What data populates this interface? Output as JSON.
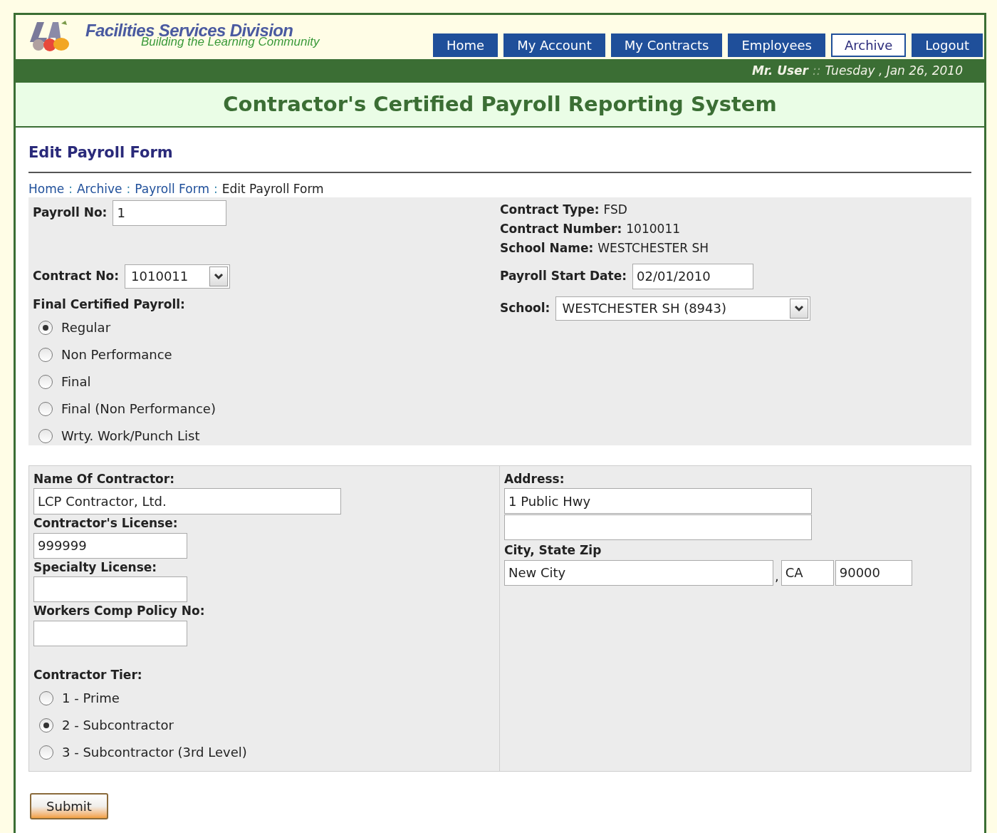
{
  "header": {
    "org_name": "Facilities Services Division",
    "tagline": "Building the Learning Community"
  },
  "nav": [
    {
      "label": "Home",
      "selected": false
    },
    {
      "label": "My Account",
      "selected": false
    },
    {
      "label": "My Contracts",
      "selected": false
    },
    {
      "label": "Employees",
      "selected": false
    },
    {
      "label": "Archive",
      "selected": true
    },
    {
      "label": "Logout",
      "selected": false
    }
  ],
  "user_bar": {
    "user": "Mr. User",
    "separator": "::",
    "date": "Tuesday , Jan 26, 2010"
  },
  "system_title": "Contractor's Certified Payroll Reporting System",
  "page_title": "Edit Payroll Form",
  "breadcrumb": [
    {
      "label": "Home",
      "kind": "link"
    },
    {
      "label": "Archive",
      "kind": "link"
    },
    {
      "label": "Payroll Form",
      "kind": "link"
    },
    {
      "label": "Edit Payroll Form",
      "kind": "current"
    }
  ],
  "breadcrumb_separator": ":",
  "payroll": {
    "payroll_no": {
      "label": "Payroll No:",
      "value": "1"
    },
    "contract_no": {
      "label": "Contract No:",
      "value": "1010011"
    },
    "final_certified": {
      "label": "Final Certified Payroll:",
      "options": [
        {
          "label": "Regular",
          "selected": true
        },
        {
          "label": "Non Performance",
          "selected": false
        },
        {
          "label": "Final",
          "selected": false
        },
        {
          "label": "Final (Non Performance)",
          "selected": false
        },
        {
          "label": "Wrty. Work/Punch List",
          "selected": false
        }
      ]
    },
    "info": [
      {
        "label": "Contract Type:",
        "value": "FSD"
      },
      {
        "label": "Contract Number:",
        "value": "1010011"
      },
      {
        "label": "School Name:",
        "value": "WESTCHESTER SH"
      }
    ],
    "start_date": {
      "label": "Payroll Start Date:",
      "value": "02/01/2010"
    },
    "school": {
      "label": "School:",
      "value": "WESTCHESTER SH (8943)"
    }
  },
  "contractor": {
    "name": {
      "label": "Name Of Contractor:",
      "value": "LCP Contractor, Ltd."
    },
    "license": {
      "label": "Contractor's License:",
      "value": "999999"
    },
    "specialty": {
      "label": "Specialty License:"
    },
    "workers_comp": {
      "label": "Workers Comp Policy No:"
    },
    "tier": {
      "label": "Contractor Tier:",
      "options": [
        {
          "label": "1 - Prime",
          "selected": false
        },
        {
          "label": "2 - Subcontractor",
          "selected": true
        },
        {
          "label": "3 - Subcontractor (3rd Level)",
          "selected": false
        }
      ]
    },
    "address": {
      "label": "Address:",
      "line1": "1 Public Hwy"
    },
    "city_state_zip": {
      "label": "City, State Zip",
      "city": "New City",
      "comma": ",",
      "state": "CA",
      "zip": "90000"
    }
  },
  "submit": "Submit"
}
